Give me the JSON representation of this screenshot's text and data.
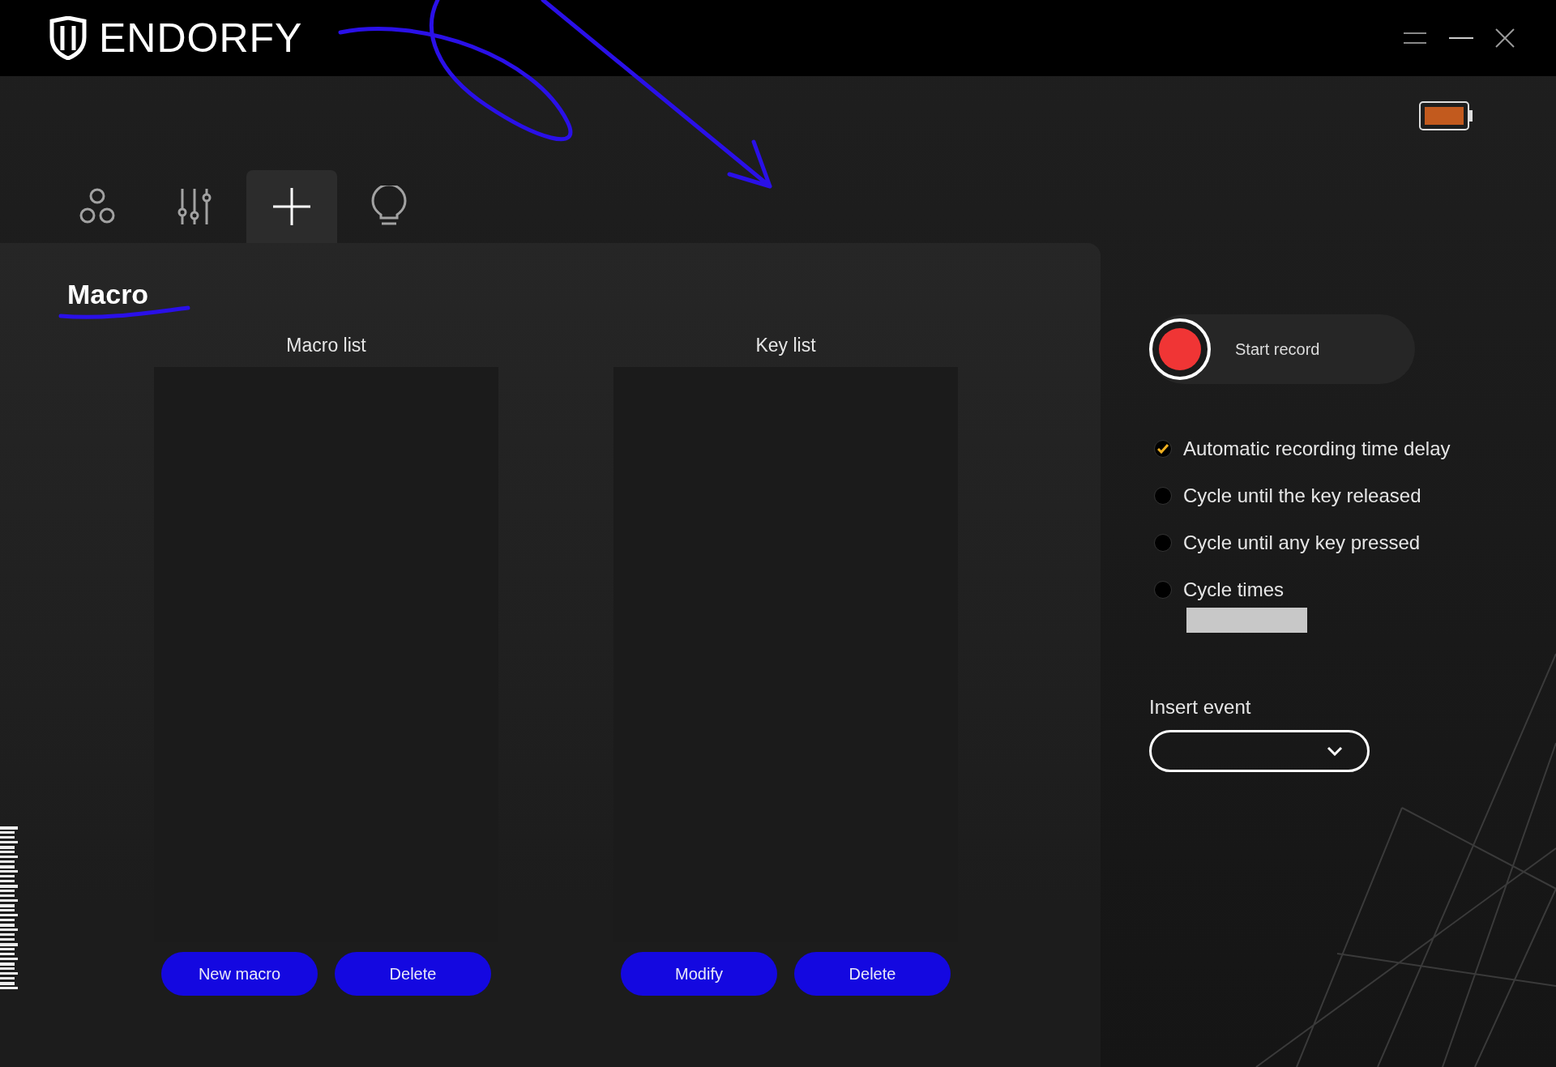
{
  "header": {
    "brand": "ENDORFY"
  },
  "tabs": [
    {
      "selected": false
    },
    {
      "selected": false
    },
    {
      "selected": true
    },
    {
      "selected": false
    }
  ],
  "page_title": "Macro",
  "lists": [
    {
      "title": "Macro list",
      "buttons": [
        "New macro",
        "Delete"
      ]
    },
    {
      "title": "Key list",
      "buttons": [
        "Modify",
        "Delete"
      ]
    }
  ],
  "record": {
    "label": "Start record"
  },
  "options": [
    {
      "label": "Automatic recording time delay",
      "checked": true
    },
    {
      "label": "Cycle until the key released",
      "checked": false
    },
    {
      "label": "Cycle until any key pressed",
      "checked": false
    },
    {
      "label": "Cycle times",
      "checked": false
    }
  ],
  "insert_event": {
    "label": "Insert event"
  }
}
